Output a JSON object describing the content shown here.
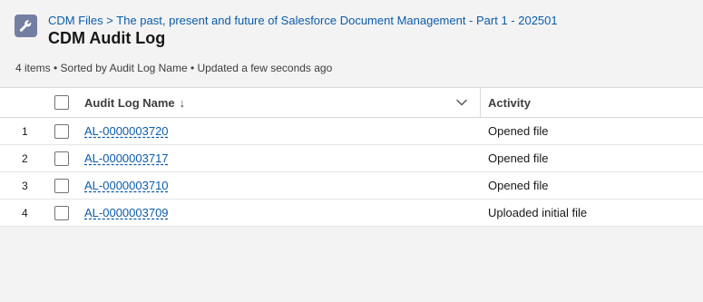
{
  "header": {
    "icon": "wrench-icon",
    "breadcrumb": {
      "parent": "CDM Files",
      "separator": ">",
      "record": "The past, present and future of Salesforce Document Management - Part 1 - 202501"
    },
    "title": "CDM Audit Log",
    "summary": "4 items • Sorted by Audit Log Name • Updated a few seconds ago"
  },
  "table": {
    "columns": {
      "name": "Audit Log Name",
      "sort_indicator": "↓",
      "activity": "Activity"
    },
    "rows": [
      {
        "num": "1",
        "name": "AL-0000003720",
        "activity": "Opened file"
      },
      {
        "num": "2",
        "name": "AL-0000003717",
        "activity": "Opened file"
      },
      {
        "num": "3",
        "name": "AL-0000003710",
        "activity": "Opened file"
      },
      {
        "num": "4",
        "name": "AL-0000003709",
        "activity": "Uploaded initial file"
      }
    ]
  },
  "colors": {
    "icon_bg": "#747ea3",
    "link": "#0b5cab",
    "page_bg": "#f3f3f3"
  }
}
